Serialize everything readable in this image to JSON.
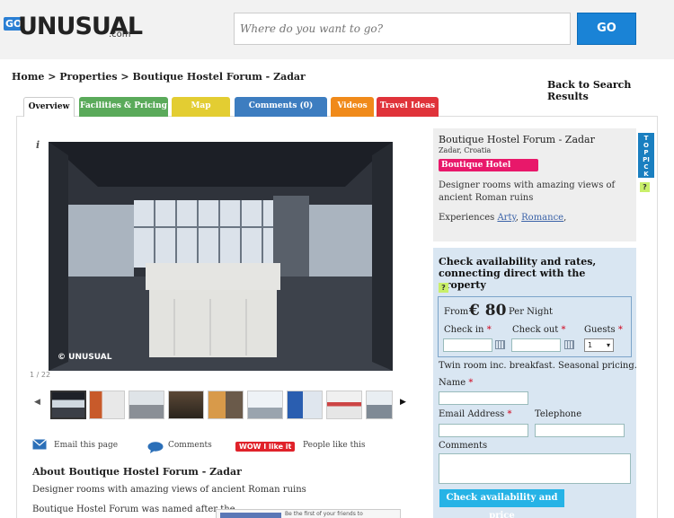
{
  "header": {
    "logo_go": "GO",
    "logo_name": "UNUSUAL",
    "logo_tld": ".com",
    "search_placeholder": "Where do you want to go?",
    "go_label": "GO"
  },
  "breadcrumb": "Home > Properties > Boutique Hostel Forum - Zadar",
  "back_link": "Back to Search Results",
  "tabs": [
    {
      "label": "Overview",
      "color": "#ffffff"
    },
    {
      "label": "Facilities & Pricing",
      "color": "#5aaa5a"
    },
    {
      "label": "Map",
      "color": "#e3cd32"
    },
    {
      "label": "Comments (0)",
      "color": "#3d7dc0"
    },
    {
      "label": "Videos",
      "color": "#f08a1a"
    },
    {
      "label": "Travel Ideas",
      "color": "#e0333a"
    }
  ],
  "gallery": {
    "info_icon": "i",
    "counter": "1 / 22",
    "watermark": "© UNUSUAL",
    "prev_icon": "chevron-left-icon",
    "next_icon": "chevron-right-icon"
  },
  "share": {
    "email_label": "Email this page",
    "comments_label": "Comments",
    "like_badge": "WOW I like it",
    "people_like": "People like this"
  },
  "about": {
    "title": "About Boutique Hostel Forum - Zadar",
    "tagline": "Designer rooms with amazing views of ancient Roman ruins",
    "body_start": "Boutique Hostel Forum was named after the",
    "fb_text": "Be the first of your friends to"
  },
  "property": {
    "title": "Boutique Hostel Forum - Zadar",
    "location": "Zadar, Croatia",
    "category": "Boutique Hotel",
    "description": "Designer rooms with amazing views of ancient Roman ruins",
    "experiences_label": "Experiences",
    "experiences": [
      "Arty",
      "Romance"
    ],
    "top_pick": "TOP PICK",
    "help": "?"
  },
  "booking": {
    "title": "Check availability and rates, connecting direct with the property",
    "from_label": "From",
    "price": "€ 80",
    "per_night": "Per Night",
    "checkin_label": "Check in",
    "checkout_label": "Check out",
    "guests_label": "Guests",
    "guests_value": "1",
    "room_note": "Twin room inc. breakfast. Seasonal pricing.",
    "name_label": "Name",
    "email_label": "Email Address",
    "phone_label": "Telephone",
    "comments_label": "Comments",
    "submit_label": "Check availability and price",
    "required_mark": "*"
  }
}
